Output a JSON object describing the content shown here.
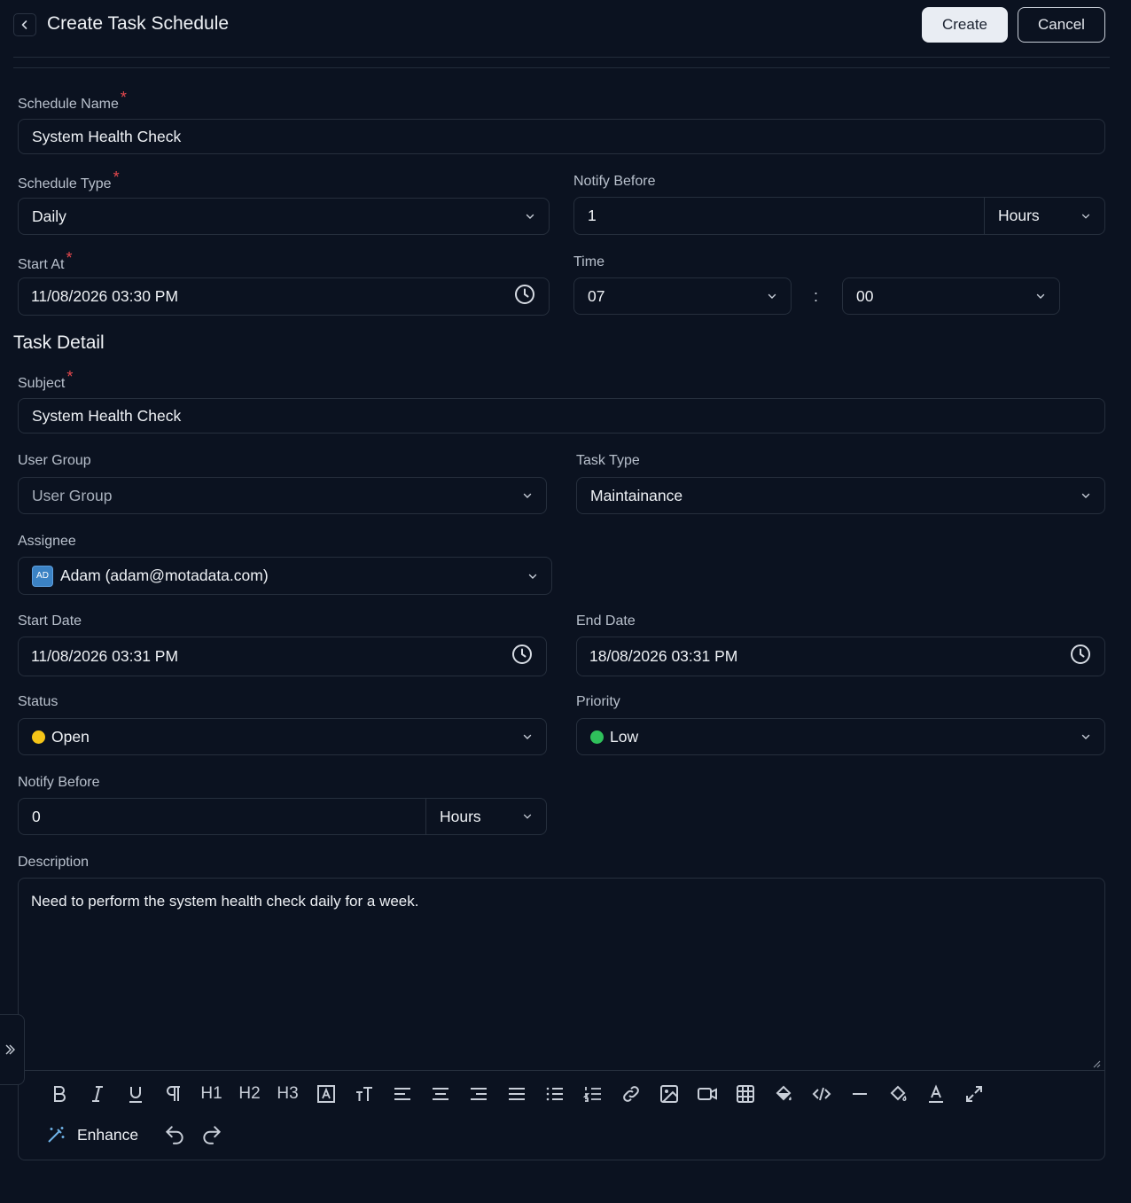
{
  "header": {
    "title": "Create Task Schedule",
    "create_label": "Create",
    "cancel_label": "Cancel"
  },
  "schedule": {
    "name_label": "Schedule Name",
    "name_value": "System Health Check",
    "type_label": "Schedule Type",
    "type_value": "Daily",
    "notify_label": "Notify Before",
    "notify_value": "1",
    "notify_unit": "Hours",
    "start_label": "Start At",
    "start_value": "11/08/2026 03:30 PM",
    "time_label": "Time",
    "time_hour": "07",
    "time_sep": ":",
    "time_minute": "00"
  },
  "task": {
    "section_title": "Task Detail",
    "subject_label": "Subject",
    "subject_value": "System Health Check",
    "user_group_label": "User Group",
    "user_group_placeholder": "User Group",
    "task_type_label": "Task Type",
    "task_type_value": "Maintainance",
    "assignee_label": "Assignee",
    "assignee_initials": "AD",
    "assignee_value": "Adam (adam@motadata.com)",
    "start_date_label": "Start Date",
    "start_date_value": "11/08/2026 03:31 PM",
    "end_date_label": "End Date",
    "end_date_value": "18/08/2026 03:31 PM",
    "status_label": "Status",
    "status_value": "Open",
    "status_color": "#f5c518",
    "priority_label": "Priority",
    "priority_value": "Low",
    "priority_color": "#2fc15b",
    "notify_label": "Notify Before",
    "notify_value": "0",
    "notify_unit": "Hours",
    "description_label": "Description",
    "description_value": "Need to perform the system health check daily for a week."
  },
  "editor": {
    "enhance_label": "Enhance",
    "h1": "H1",
    "h2": "H2",
    "h3": "H3"
  },
  "colors": {
    "background": "#0b1220",
    "border": "#262f3d",
    "required": "#e5484d",
    "primary_button": "#e9edf3"
  }
}
